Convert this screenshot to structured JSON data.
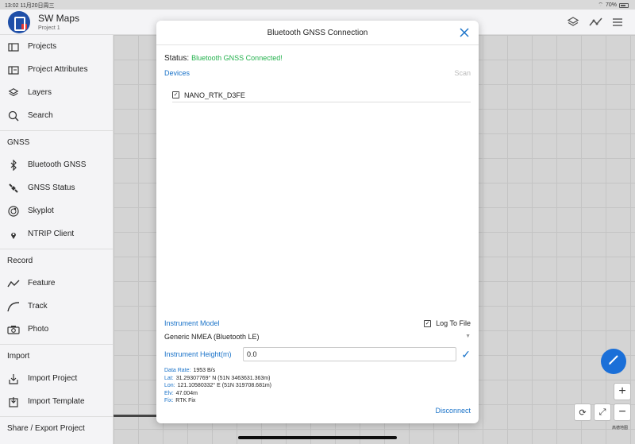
{
  "status_bar": {
    "time": "13:02",
    "date": "11月20日周三",
    "battery": "70%",
    "battery_level": 0.7
  },
  "app": {
    "name": "SW Maps",
    "project": "Project 1"
  },
  "top_icons": [
    "layers-icon",
    "chart-line-icon",
    "menu-icon"
  ],
  "sidebar": {
    "items_top": [
      {
        "label": "Projects",
        "icon": "folder-icon"
      },
      {
        "label": "Project Attributes",
        "icon": "folder-attributes-icon"
      },
      {
        "label": "Layers",
        "icon": "layers-icon"
      },
      {
        "label": "Search",
        "icon": "search-icon"
      }
    ],
    "gnss_header": "GNSS",
    "gnss_items": [
      {
        "label": "Bluetooth GNSS",
        "icon": "bluetooth-icon"
      },
      {
        "label": "GNSS Status",
        "icon": "satellite-icon"
      },
      {
        "label": "Skyplot",
        "icon": "skyplot-icon"
      },
      {
        "label": "NTRIP Client",
        "icon": "ntrip-icon"
      }
    ],
    "record_header": "Record",
    "record_items": [
      {
        "label": "Feature",
        "icon": "polyline-icon"
      },
      {
        "label": "Track",
        "icon": "track-icon"
      },
      {
        "label": "Photo",
        "icon": "camera-icon"
      }
    ],
    "import_header": "Import",
    "import_items": [
      {
        "label": "Import Project",
        "icon": "import-icon"
      },
      {
        "label": "Import Template",
        "icon": "import-template-icon"
      }
    ],
    "share_header": "Share / Export Project"
  },
  "modal": {
    "title": "Bluetooth GNSS Connection",
    "status_label": "Status:",
    "status_value": "Bluetooth GNSS Connected!",
    "devices_label": "Devices",
    "scan_label": "Scan",
    "device_name": "NANO_RTK_D3FE",
    "device_checked": true,
    "instrument_model_label": "Instrument Model",
    "log_to_file_label": "Log To File",
    "log_to_file_checked": true,
    "instrument_model_value": "Generic NMEA (Bluetooth LE)",
    "instrument_height_label": "Instrument Height(m)",
    "instrument_height_value": "0.0",
    "info": {
      "data_rate_label": "Data Rate:",
      "data_rate_value": "1953 B/s",
      "lat_label": "Lat:",
      "lat_value": "31.29307769° N (51N 3463631.363m)",
      "lon_label": "Lon:",
      "lon_value": "121.10580332° E (51N 319708.681m)",
      "elv_label": "Elv:",
      "elv_value": "47.004m",
      "fix_label": "Fix:",
      "fix_value": "RTK Fix"
    },
    "disconnect_label": "Disconnect"
  },
  "map": {
    "attribution": "高德地图"
  },
  "colors": {
    "accent": "#1a73c9",
    "connected": "#21b04b",
    "fab": "#1a6fd8"
  }
}
